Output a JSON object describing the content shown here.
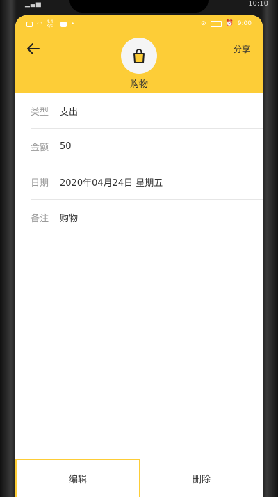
{
  "device_status": {
    "time": "10:10"
  },
  "status_bar": {
    "net_speed": "4.4 K/s",
    "time": "9:00"
  },
  "header": {
    "category_title": "购物",
    "share_label": "分享",
    "back_icon": "arrow-left-icon",
    "category_icon": "shopping-bag-icon",
    "accent_color": "#FDCD37"
  },
  "details": [
    {
      "label": "类型",
      "value": "支出"
    },
    {
      "label": "金额",
      "value": "50"
    },
    {
      "label": "日期",
      "value": "2020年04月24日 星期五"
    },
    {
      "label": "备注",
      "value": "购物"
    }
  ],
  "actions": {
    "edit_label": "编辑",
    "delete_label": "删除"
  }
}
